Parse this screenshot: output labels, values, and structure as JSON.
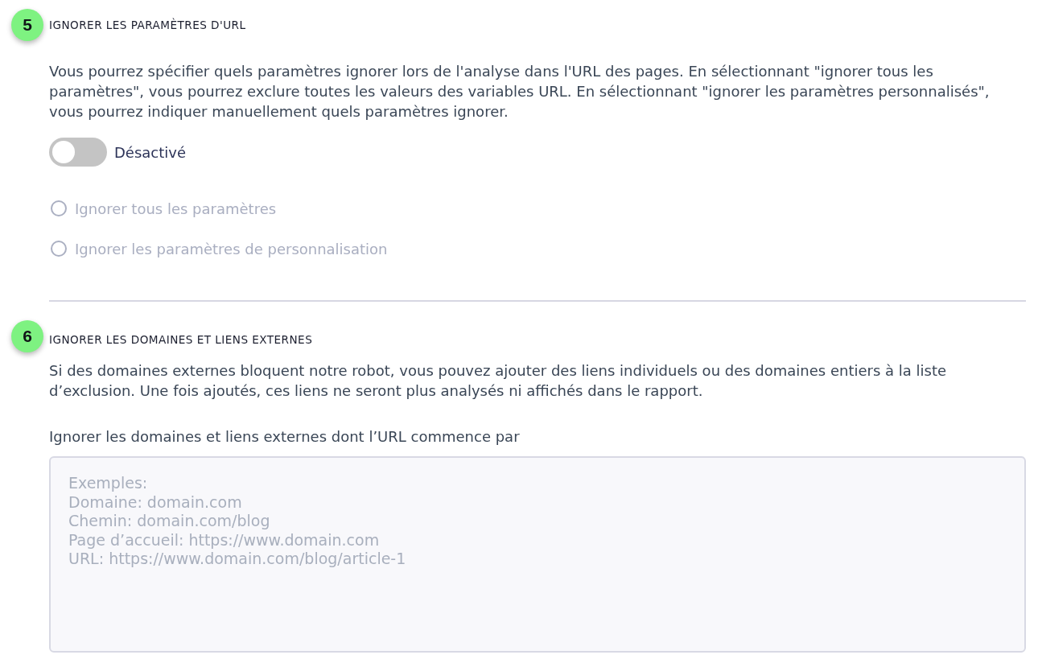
{
  "sections": [
    {
      "step": "5",
      "title": "IGNORER LES PARAMÈTRES D'URL",
      "description": "Vous pourrez spécifier quels paramètres ignorer lors de l'analyse dans l'URL des pages. En sélectionnant \"ignorer tous les paramètres\", vous pourrez exclure toutes les valeurs des variables URL. En sélectionnant \"ignorer les paramètres personnalisés\", vous pourrez indiquer manuellement quels paramètres ignorer.",
      "toggle": {
        "on": false,
        "label": "Désactivé"
      },
      "options": [
        {
          "label": "Ignorer tous les paramètres",
          "selected": false,
          "disabled": true
        },
        {
          "label": "Ignorer les paramètres de personnalisation",
          "selected": false,
          "disabled": true
        }
      ]
    },
    {
      "step": "6",
      "title": "IGNORER LES DOMAINES ET LIENS EXTERNES",
      "description": "Si des domaines externes bloquent notre robot, vous pouvez ajouter des liens individuels ou des domaines entiers à la liste d’exclusion. Une fois ajoutés, ces liens ne seront plus analysés ni affichés dans le rapport.",
      "field": {
        "label": "Ignorer les domaines et liens externes dont l’URL commence par",
        "placeholder": "Exemples:\nDomaine: domain.com\nChemin: domain.com/blog\nPage d’accueil: https://www.domain.com\nURL: https://www.domain.com/blog/article-1"
      }
    }
  ]
}
